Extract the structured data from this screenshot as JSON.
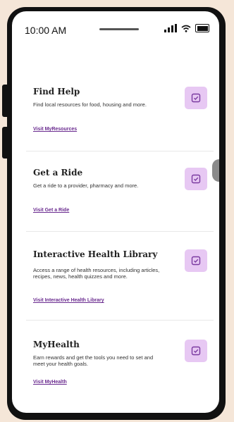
{
  "status": {
    "time": "10:00 AM"
  },
  "cards": [
    {
      "title": "Find Help",
      "description": "Find local resources for food, housing and more.",
      "link": "Visit MyResources",
      "icon": "checkbox-icon"
    },
    {
      "title": "Get a Ride",
      "description": "Get a ride to a provider, pharmacy and more.",
      "link": "Visit Get a Ride",
      "icon": "checkbox-icon"
    },
    {
      "title": "Interactive Health Library",
      "description": "Access a range of health resources, including articles, recipes, news, health quizzes and more.",
      "link": "Visit Interactive Health Library",
      "icon": "checkbox-icon"
    },
    {
      "title": "MyHealth",
      "description": "Earn rewards and get the tools you need to set and meet your health goals.",
      "link": "Visit MyHealth",
      "icon": "checkbox-icon"
    }
  ],
  "colors": {
    "accent": "#6a2b8f",
    "icon_bg": "#e7c8f3",
    "icon_stroke": "#7a3aa0"
  }
}
